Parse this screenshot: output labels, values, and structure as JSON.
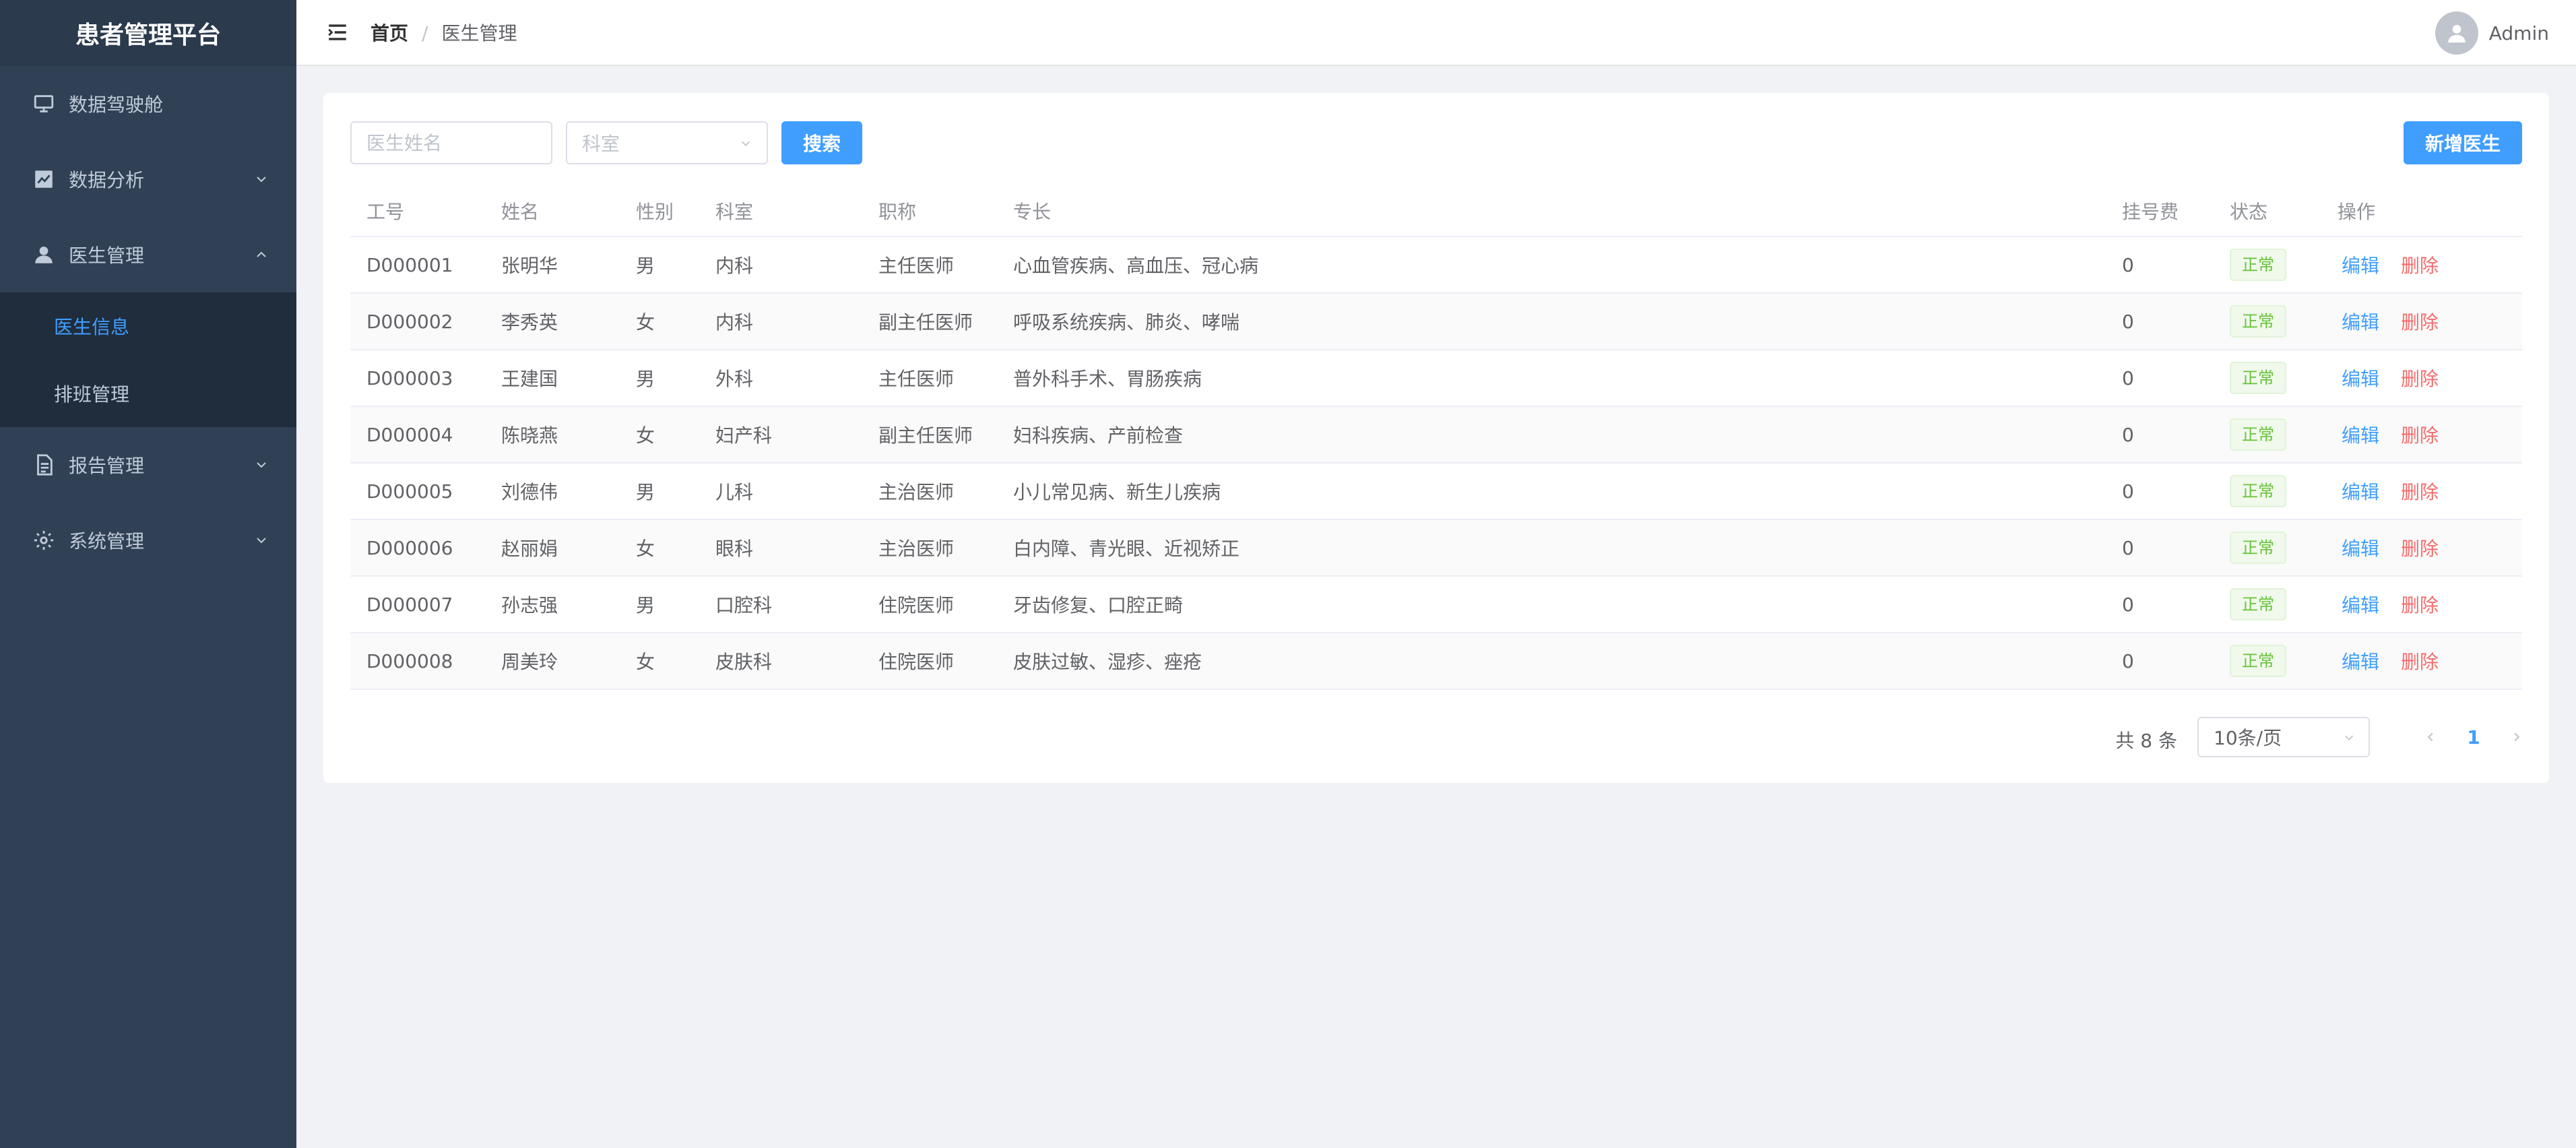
{
  "app": {
    "title": "患者管理平台"
  },
  "sidebar": {
    "items": [
      {
        "label": "数据驾驶舱",
        "icon": "monitor-icon"
      },
      {
        "label": "数据分析",
        "icon": "chart-icon"
      },
      {
        "label": "医生管理",
        "icon": "user-icon"
      },
      {
        "label": "报告管理",
        "icon": "document-icon"
      },
      {
        "label": "系统管理",
        "icon": "gear-icon"
      }
    ],
    "sub_items": [
      {
        "label": "医生信息",
        "active": true
      },
      {
        "label": "排班管理",
        "active": false
      }
    ]
  },
  "header": {
    "breadcrumb": {
      "home": "首页",
      "separator": "/",
      "current": "医生管理"
    },
    "user": {
      "name": "Admin"
    }
  },
  "filters": {
    "name_placeholder": "医生姓名",
    "dept_placeholder": "科室",
    "search_label": "搜索",
    "add_label": "新增医生"
  },
  "table": {
    "columns": [
      "工号",
      "姓名",
      "性别",
      "科室",
      "职称",
      "专长",
      "挂号费",
      "状态",
      "操作"
    ],
    "edit_label": "编辑",
    "delete_label": "删除",
    "rows": [
      {
        "id": "D000001",
        "name": "张明华",
        "gender": "男",
        "dept": "内科",
        "title": "主任医师",
        "specialty": "心血管疾病、高血压、冠心病",
        "fee": "0",
        "status": "正常"
      },
      {
        "id": "D000002",
        "name": "李秀英",
        "gender": "女",
        "dept": "内科",
        "title": "副主任医师",
        "specialty": "呼吸系统疾病、肺炎、哮喘",
        "fee": "0",
        "status": "正常"
      },
      {
        "id": "D000003",
        "name": "王建国",
        "gender": "男",
        "dept": "外科",
        "title": "主任医师",
        "specialty": "普外科手术、胃肠疾病",
        "fee": "0",
        "status": "正常"
      },
      {
        "id": "D000004",
        "name": "陈晓燕",
        "gender": "女",
        "dept": "妇产科",
        "title": "副主任医师",
        "specialty": "妇科疾病、产前检查",
        "fee": "0",
        "status": "正常"
      },
      {
        "id": "D000005",
        "name": "刘德伟",
        "gender": "男",
        "dept": "儿科",
        "title": "主治医师",
        "specialty": "小儿常见病、新生儿疾病",
        "fee": "0",
        "status": "正常"
      },
      {
        "id": "D000006",
        "name": "赵丽娟",
        "gender": "女",
        "dept": "眼科",
        "title": "主治医师",
        "specialty": "白内障、青光眼、近视矫正",
        "fee": "0",
        "status": "正常"
      },
      {
        "id": "D000007",
        "name": "孙志强",
        "gender": "男",
        "dept": "口腔科",
        "title": "住院医师",
        "specialty": "牙齿修复、口腔正畸",
        "fee": "0",
        "status": "正常"
      },
      {
        "id": "D000008",
        "name": "周美玲",
        "gender": "女",
        "dept": "皮肤科",
        "title": "住院医师",
        "specialty": "皮肤过敏、湿疹、痤疮",
        "fee": "0",
        "status": "正常"
      }
    ]
  },
  "pagination": {
    "total_text": "共 8 条",
    "page_size": "10条/页",
    "current_page": "1"
  },
  "colors": {
    "sidebar_bg": "#304156",
    "brand_bg": "#2b3a4d",
    "accent": "#409eff",
    "danger": "#f56c6c",
    "success": "#67c23a"
  }
}
